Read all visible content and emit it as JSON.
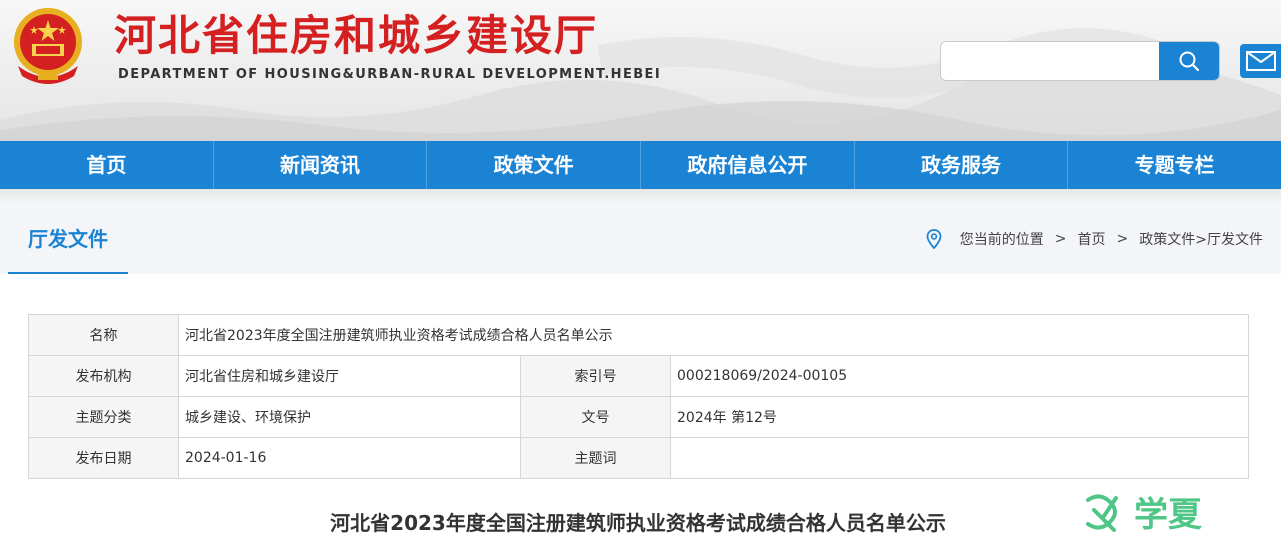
{
  "header": {
    "title": "河北省住房和城乡建设厅",
    "subtitle": "DEPARTMENT OF HOUSING&URBAN-RURAL DEVELOPMENT.HEBEI",
    "search": {
      "placeholder": "",
      "button_icon": "search-icon"
    },
    "mail_icon": "mail-icon",
    "emblem_icon": "national-emblem-icon"
  },
  "nav": {
    "items": [
      {
        "label": "首页"
      },
      {
        "label": "新闻资讯"
      },
      {
        "label": "政策文件"
      },
      {
        "label": "政府信息公开"
      },
      {
        "label": "政务服务"
      },
      {
        "label": "专题专栏"
      }
    ]
  },
  "section": {
    "title": "厅发文件",
    "breadcrumb": {
      "prefix": "您当前的位置",
      "home": "首页",
      "path": "政策文件>厅发文件",
      "sep": ">"
    }
  },
  "meta": {
    "name_label": "名称",
    "name_value": "河北省2023年度全国注册建筑师执业资格考试成绩合格人员名单公示",
    "org_label": "发布机构",
    "org_value": "河北省住房和城乡建设厅",
    "index_label": "索引号",
    "index_value": "000218069/2024-00105",
    "category_label": "主题分类",
    "category_value": "城乡建设、环境保护",
    "docno_label": "文号",
    "docno_value": "2024年 第12号",
    "date_label": "发布日期",
    "date_value": "2024-01-16",
    "keywords_label": "主题词",
    "keywords_value": ""
  },
  "document": {
    "title": "河北省2023年度全国注册建筑师执业资格考试成绩合格人员名单公示"
  },
  "watermark": {
    "text": "学夏"
  },
  "colors": {
    "brand_blue": "#1a83d4",
    "title_red": "#d42020"
  }
}
